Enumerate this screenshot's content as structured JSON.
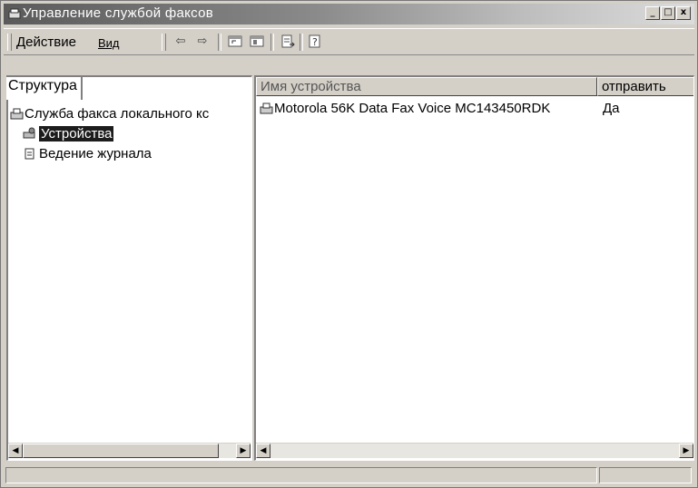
{
  "window": {
    "title": "Управление службой факсов",
    "minimize_label": "_",
    "maximize_label": "□",
    "close_label": "x"
  },
  "menu": {
    "action": "Действие",
    "view": "Вид"
  },
  "toolbar": {
    "icons": [
      "back-arrow-icon",
      "forward-arrow-icon",
      "up-folder-icon",
      "show-hide-tree-icon",
      "export-list-icon",
      "help-icon"
    ]
  },
  "tree_pane": {
    "tab_label": "Структура",
    "items": [
      {
        "label": "Служба факса локального кс",
        "icon": "fax-service-icon",
        "selected": false
      },
      {
        "label": "Устройства",
        "icon": "devices-icon",
        "selected": true
      },
      {
        "label": "Ведение журнала",
        "icon": "logging-icon",
        "selected": false
      }
    ]
  },
  "list_pane": {
    "columns": [
      "Имя устройства",
      "отправить"
    ],
    "rows": [
      {
        "name": "Motorola 56K Data Fax Voice MC143450RDK",
        "send": "Да",
        "icon": "fax-modem-icon"
      }
    ]
  },
  "colors": {
    "selection_bg": "#1c1c1c",
    "face": "#d4d0c8"
  }
}
